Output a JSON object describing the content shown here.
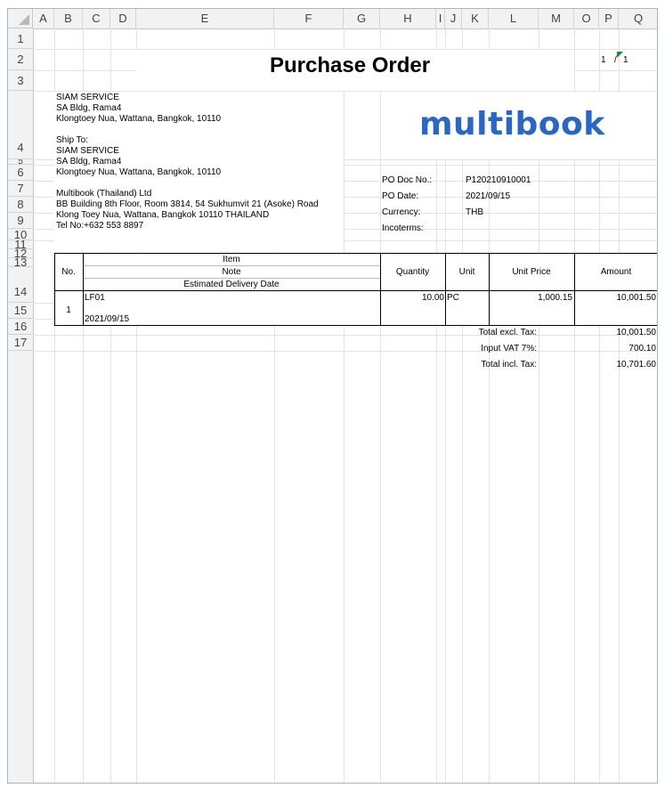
{
  "columns": [
    "A",
    "B",
    "C",
    "D",
    "E",
    "F",
    "G",
    "H",
    "I",
    "J",
    "K",
    "L",
    "M",
    "O",
    "P",
    "Q"
  ],
  "rows": [
    "1",
    "2",
    "3",
    "4",
    "5",
    "6",
    "7",
    "8",
    "9",
    "10",
    "11",
    "12",
    "13",
    "14",
    "15",
    "16",
    "17"
  ],
  "doc": {
    "title": "Purchase Order",
    "page_no": "1",
    "page_sep": "/",
    "page_total": "1",
    "vendor": [
      "SIAM SERVICE",
      "SA Bldg, Rama4",
      "Klongtoey Nua, Wattana, Bangkok, 10110"
    ],
    "ship_to_label": "Ship To:",
    "ship_to": [
      "SIAM SERVICE",
      "SA Bldg, Rama4",
      "Klongtoey Nua, Wattana, Bangkok, 10110"
    ],
    "buyer": [
      "Multibook (Thailand) Ltd",
      "BB Building 8th Floor, Room 3814, 54 Sukhumvit 21 (Asoke) Road",
      "Klong Toey Nua, Wattana, Bangkok 10110 THAILAND",
      "Tel No:+632 553 8897"
    ],
    "logo_text": "multibook",
    "info": [
      {
        "label": "PO Doc No.:",
        "value": "P120210910001"
      },
      {
        "label": "PO Date:",
        "value": "2021/09/15"
      },
      {
        "label": "Currency:",
        "value": "THB"
      },
      {
        "label": "Incoterms:",
        "value": ""
      }
    ],
    "table_headers": {
      "no": "No.",
      "item": "Item",
      "note": "Note",
      "delivery": "Estimated Delivery Date",
      "quantity": "Quantity",
      "unit": "Unit",
      "unit_price": "Unit Price",
      "amount": "Amount"
    },
    "line": {
      "no": "1",
      "item": "LF01",
      "delivery": "2021/09/15",
      "quantity": "10.00",
      "unit": "PC",
      "unit_price": "1,000.15",
      "amount": "10,001.50"
    },
    "totals": [
      {
        "label": "Total excl. Tax:",
        "value": "10,001.50"
      },
      {
        "label": "Input VAT 7%:",
        "value": "700.10"
      },
      {
        "label": "Total incl. Tax:",
        "value": "10,701.60"
      }
    ]
  }
}
